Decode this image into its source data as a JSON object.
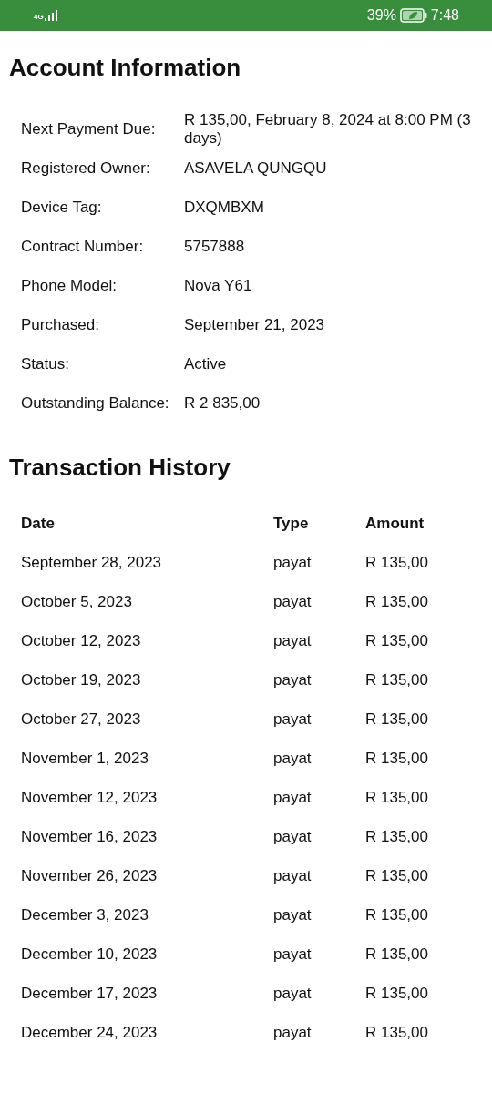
{
  "status_bar": {
    "network": "4G",
    "battery": "39%",
    "time": "7:48"
  },
  "account": {
    "title": "Account Information",
    "fields": [
      {
        "label": "Next Payment Due:",
        "value": "R 135,00, February 8, 2024 at 8:00 PM (3 days)"
      },
      {
        "label": "Registered Owner:",
        "value": "ASAVELA QUNGQU"
      },
      {
        "label": "Device Tag:",
        "value": "DXQMBXM"
      },
      {
        "label": "Contract Number:",
        "value": "5757888"
      },
      {
        "label": "Phone Model:",
        "value": "Nova Y61"
      },
      {
        "label": "Purchased:",
        "value": "September 21, 2023"
      },
      {
        "label": "Status:",
        "value": "Active"
      },
      {
        "label": "Outstanding Balance:",
        "value": "R 2 835,00"
      }
    ]
  },
  "transactions": {
    "title": "Transaction History",
    "columns": [
      "Date",
      "Type",
      "Amount"
    ],
    "rows": [
      [
        "September 28, 2023",
        "payat",
        "R 135,00"
      ],
      [
        "October 5, 2023",
        "payat",
        "R 135,00"
      ],
      [
        "October 12, 2023",
        "payat",
        "R 135,00"
      ],
      [
        "October 19, 2023",
        "payat",
        "R 135,00"
      ],
      [
        "October 27, 2023",
        "payat",
        "R 135,00"
      ],
      [
        "November 1, 2023",
        "payat",
        "R 135,00"
      ],
      [
        "November 12, 2023",
        "payat",
        "R 135,00"
      ],
      [
        "November 16, 2023",
        "payat",
        "R 135,00"
      ],
      [
        "November 26, 2023",
        "payat",
        "R 135,00"
      ],
      [
        "December 3, 2023",
        "payat",
        "R 135,00"
      ],
      [
        "December 10, 2023",
        "payat",
        "R 135,00"
      ],
      [
        "December 17, 2023",
        "payat",
        "R 135,00"
      ],
      [
        "December 24, 2023",
        "payat",
        "R 135,00"
      ]
    ]
  }
}
